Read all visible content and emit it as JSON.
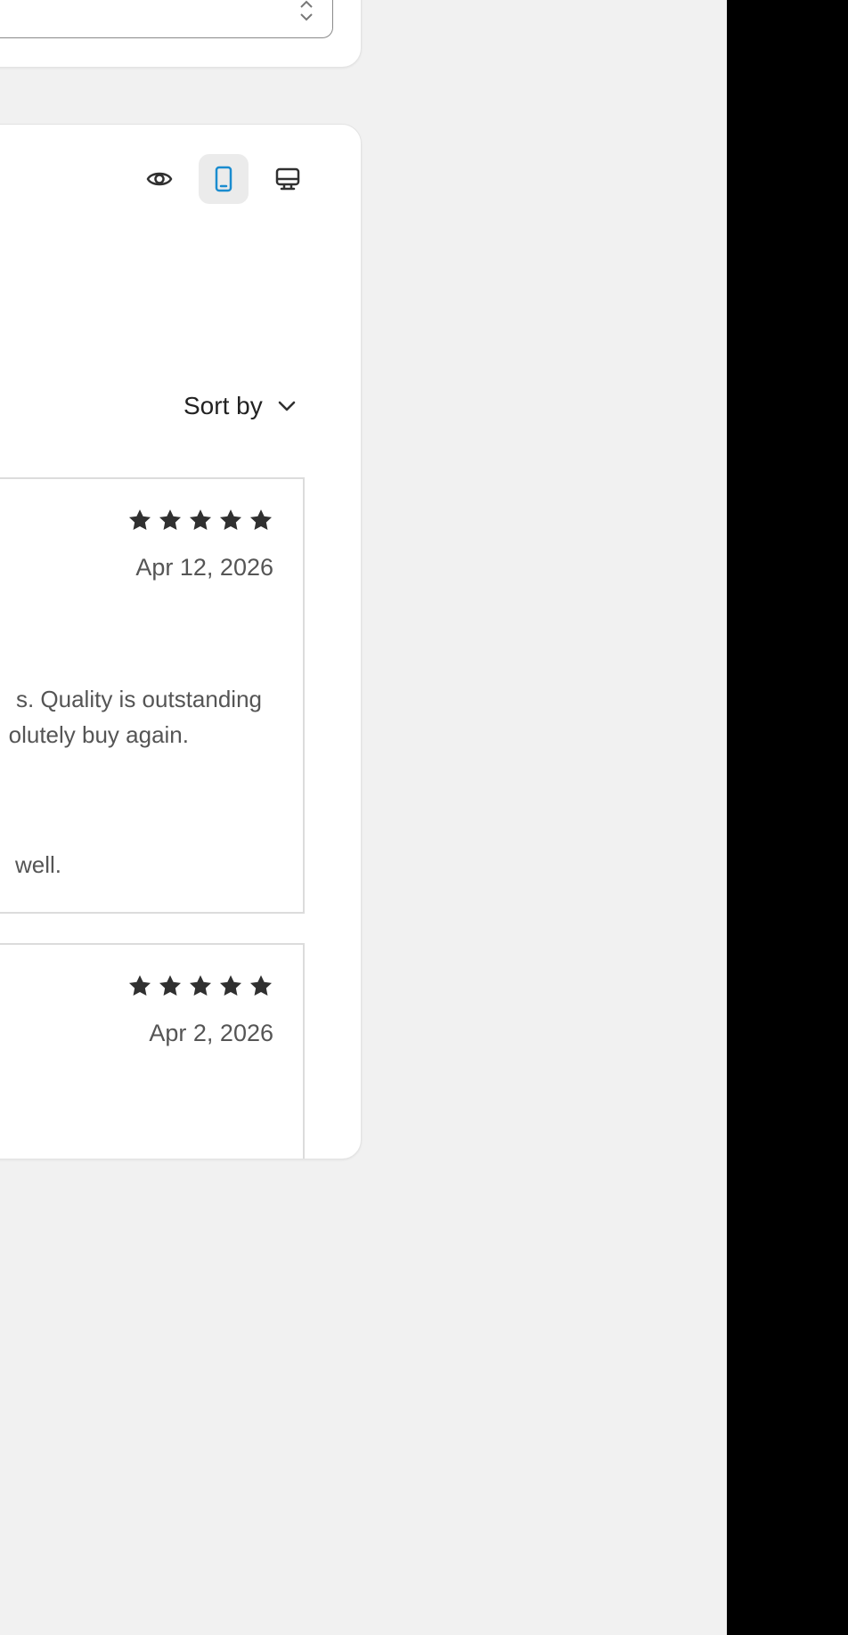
{
  "toolbar": {
    "preview_icon": "eye-icon",
    "mobile_icon": "mobile-icon",
    "desktop_icon": "desktop-icon",
    "active_view": "mobile",
    "accent_color": "#1a8ccf"
  },
  "sort": {
    "label": "Sort by",
    "icon": "chevron-down-icon"
  },
  "reviews": [
    {
      "rating": 5,
      "date": "Apr 12, 2026",
      "body_lines": [
        "s. Quality is outstanding",
        "olutely buy again.",
        " well."
      ]
    },
    {
      "rating": 5,
      "date": "Apr 2, 2026"
    }
  ],
  "colors": {
    "background": "#f1f1f1",
    "card": "#ffffff",
    "star": "#303030"
  }
}
